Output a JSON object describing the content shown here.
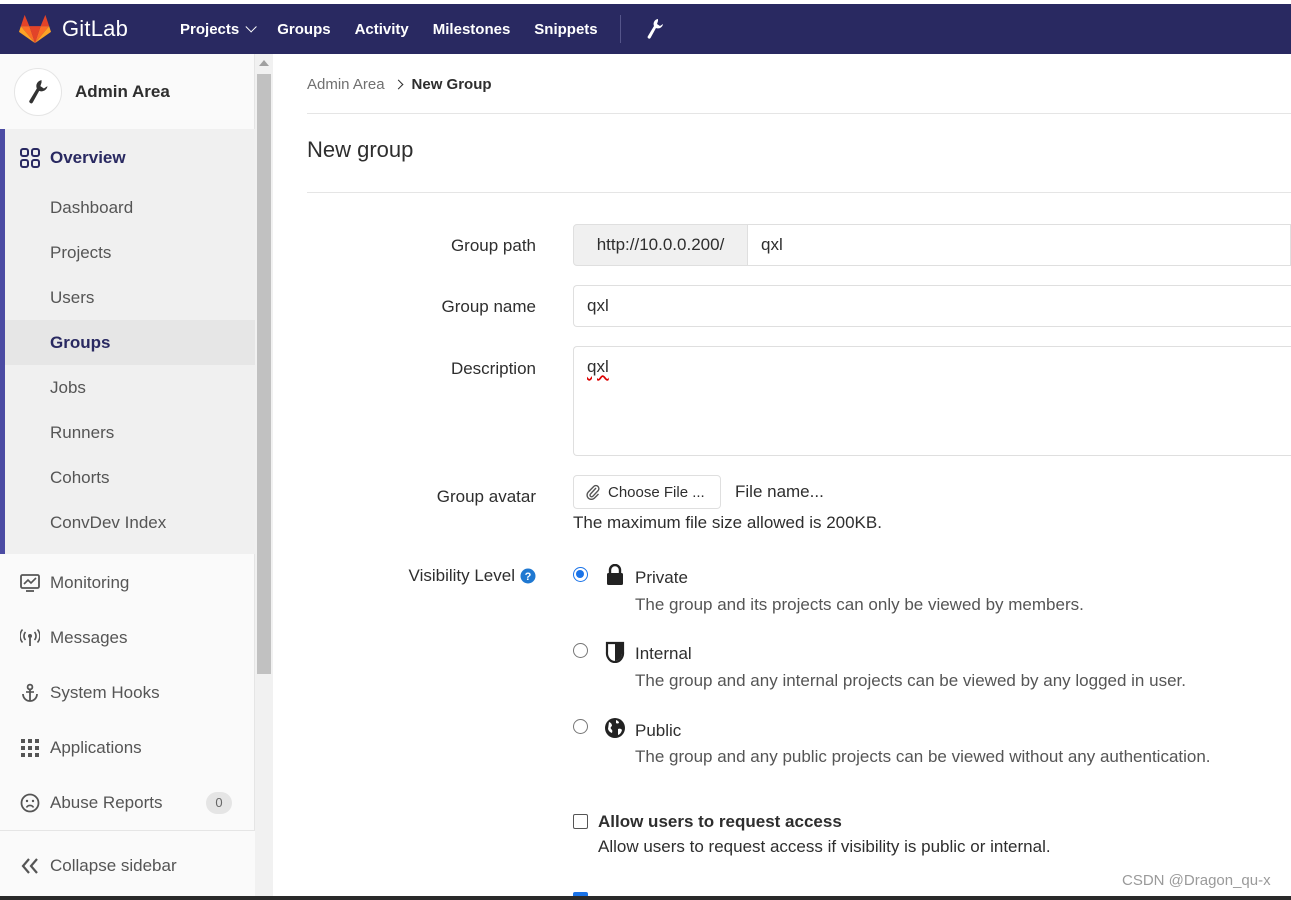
{
  "app": {
    "name": "GitLab"
  },
  "nav": {
    "projects": "Projects",
    "groups": "Groups",
    "activity": "Activity",
    "milestones": "Milestones",
    "snippets": "Snippets"
  },
  "sidebar": {
    "title": "Admin Area",
    "overview": "Overview",
    "sub_items": [
      "Dashboard",
      "Projects",
      "Users",
      "Groups",
      "Jobs",
      "Runners",
      "Cohorts",
      "ConvDev Index"
    ],
    "active_sub": "Groups",
    "items": [
      "Monitoring",
      "Messages",
      "System Hooks",
      "Applications",
      "Abuse Reports"
    ],
    "abuse_count": "0",
    "collapse": "Collapse sidebar"
  },
  "breadcrumb": {
    "root": "Admin Area",
    "current": "New Group"
  },
  "page": {
    "title": "New group"
  },
  "form": {
    "path_label": "Group path",
    "path_prefix": "http://10.0.0.200/",
    "path_value": "qxl",
    "name_label": "Group name",
    "name_value": "qxl",
    "desc_label": "Description",
    "desc_value": "qxl",
    "avatar_label": "Group avatar",
    "choose_file": "Choose File ...",
    "file_name": "File name...",
    "file_help": "The maximum file size allowed is 200KB.",
    "visibility_label": "Visibility Level",
    "visibility": [
      {
        "title": "Private",
        "desc": "The group and its projects can only be viewed by members.",
        "selected": true
      },
      {
        "title": "Internal",
        "desc": "The group and any internal projects can be viewed by any logged in user.",
        "selected": false
      },
      {
        "title": "Public",
        "desc": "The group and any public projects can be viewed without any authentication.",
        "selected": false
      }
    ],
    "request_access_label": "Allow users to request access",
    "request_access_help": "Allow users to request access if visibility is public or internal."
  },
  "watermark": "CSDN @Dragon_qu-x",
  "colors": {
    "topbar": "#292961",
    "accent": "#4b4ba3",
    "radio": "#1a73e8"
  }
}
